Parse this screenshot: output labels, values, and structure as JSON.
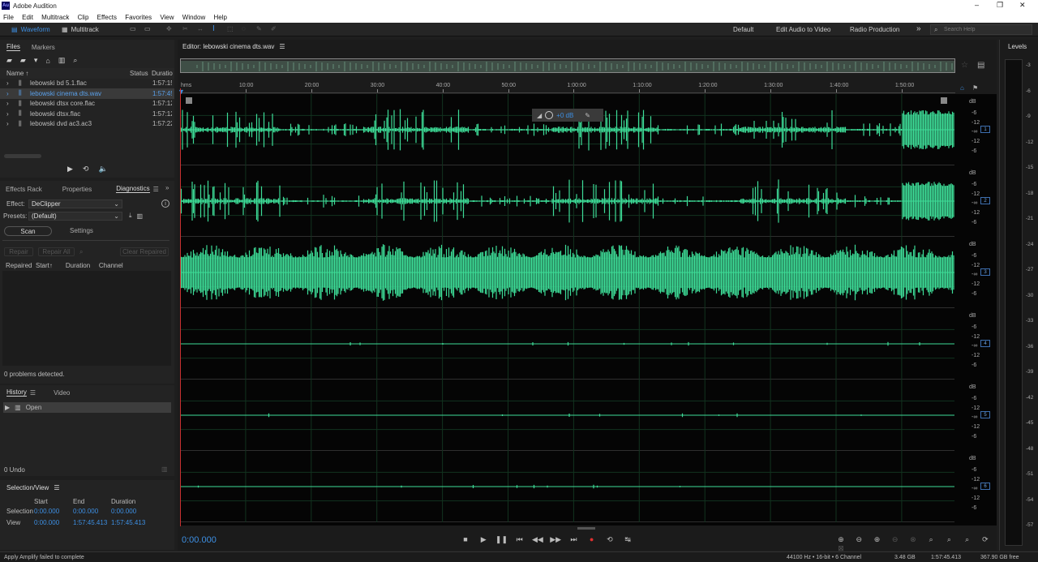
{
  "app": {
    "icon_text": "Au",
    "title": "Adobe Audition",
    "window_controls": [
      "–",
      "❐",
      "✕"
    ]
  },
  "menu": [
    "File",
    "Edit",
    "Multitrack",
    "Clip",
    "Effects",
    "Favorites",
    "View",
    "Window",
    "Help"
  ],
  "toolbar": {
    "waveform": "Waveform",
    "multitrack": "Multitrack",
    "workspaces": [
      "Default",
      "Edit Audio to Video",
      "Radio Production"
    ],
    "search_placeholder": "Search Help"
  },
  "files_panel": {
    "tabs": [
      "Files",
      "Markers"
    ],
    "columns": [
      "Name",
      "Status",
      "Duratio"
    ],
    "items": [
      {
        "name": "lebowski bd 5.1.flac",
        "duration": "1:57:15"
      },
      {
        "name": "lebowski cinema dts.wav",
        "duration": "1:57:45"
      },
      {
        "name": "lebowski dtsx core.flac",
        "duration": "1:57:12"
      },
      {
        "name": "lebowski dtsx.flac",
        "duration": "1:57:12"
      },
      {
        "name": "lebowski dvd ac3.ac3",
        "duration": "1:57:22"
      }
    ]
  },
  "diag_panel": {
    "tabs": [
      "Effects Rack",
      "Properties",
      "Diagnostics"
    ],
    "effect_label": "Effect:",
    "effect_value": "DeClipper",
    "presets_label": "Presets:",
    "presets_value": "(Default)",
    "scan": "Scan",
    "settings": "Settings",
    "repair": "Repair",
    "repair_all": "Repair All",
    "clear_repaired": "Clear Repaired",
    "columns": [
      "Repaired",
      "Start",
      "Duration",
      "Channel"
    ],
    "status": "0 problems detected."
  },
  "history_panel": {
    "tabs": [
      "History",
      "Video"
    ],
    "items": [
      "Open"
    ],
    "undo": "0 Undo"
  },
  "selection_panel": {
    "title": "Selection/View",
    "cols": [
      "Start",
      "End",
      "Duration"
    ],
    "selection_label": "Selection",
    "selection": [
      "0:00.000",
      "0:00.000",
      "0:00.000"
    ],
    "view_label": "View",
    "view": [
      "0:00.000",
      "1:57:45.413",
      "1:57:45.413"
    ]
  },
  "editor": {
    "title": "Editor: lebowski cinema dts.wav",
    "ruler": [
      "hms",
      "10:00",
      "20:00",
      "30:00",
      "40:00",
      "50:00",
      "1:00:00",
      "1:10:00",
      "1:20:00",
      "1:30:00",
      "1:40:00",
      "1:50:00"
    ],
    "hud_gain": "+0 dB",
    "db_scale": [
      "dB",
      "-6",
      "-12",
      "-∞",
      "-12",
      "-6"
    ],
    "channels": [
      "1",
      "2",
      "3",
      "4",
      "5",
      "6"
    ],
    "channel_levels": [
      0.55,
      0.55,
      0.85,
      0.12,
      0.12,
      0.12
    ],
    "time": "0:00.000",
    "waveform_color": "#3ddc97"
  },
  "levels_panel": {
    "title": "Levels",
    "scale": [
      "-3",
      "-6",
      "-9",
      "-12",
      "-15",
      "-18",
      "-21",
      "-24",
      "-27",
      "-30",
      "-33",
      "-36",
      "-39",
      "-42",
      "-45",
      "-48",
      "-51",
      "-54",
      "-57"
    ]
  },
  "statusbar": {
    "message": "Apply Amplify failed to complete",
    "format": "44100 Hz • 16-bit • 6 Channel",
    "size": "3.48 GB",
    "duration": "1:57:45.413",
    "free": "367.90 GB free"
  },
  "colors": {
    "accent": "#3d8fe3",
    "waveform": "#3ddc97",
    "record": "#e03030"
  }
}
